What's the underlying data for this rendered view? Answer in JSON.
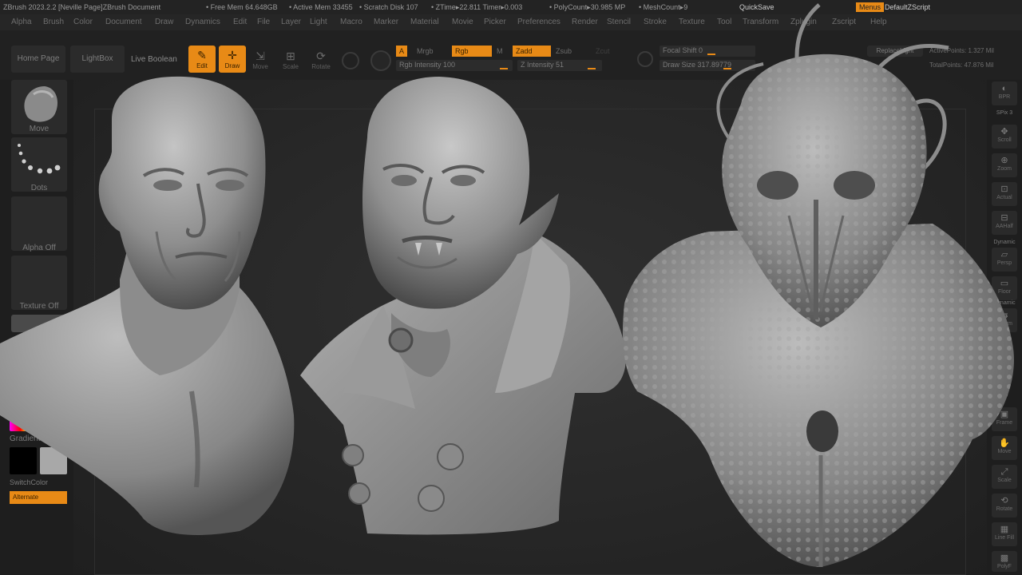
{
  "titlebar": {
    "app": "ZBrush 2023.2.2 [Neville Page]ZBrush Document",
    "free_mem": "• Free Mem 64.648GB",
    "active_mem": "• Active Mem 33455",
    "scratch": "• Scratch Disk 107",
    "ztime": "• ZTime▸22.811 Timer▸0.003",
    "polycount": "• PolyCount▸30.985 MP",
    "meshcount": "• MeshCount▸9",
    "quicksave": "QuickSave",
    "menus_label": "Menus",
    "script_label": "DefaultZScript"
  },
  "menubar": [
    "Alpha",
    "Brush",
    "Color",
    "Document",
    "Draw",
    "Dynamics",
    "Edit",
    "File",
    "Layer",
    "Light",
    "Macro",
    "Marker",
    "Material",
    "Movie",
    "Picker",
    "Preferences",
    "Render",
    "Stencil",
    "Stroke",
    "Texture",
    "Tool",
    "Transform",
    "Zplugin",
    "Zscript",
    "Help"
  ],
  "shelf": {
    "home": "Home Page",
    "lightbox": "LightBox",
    "live_boolean": "Live Boolean",
    "edit": "Edit",
    "draw": "Draw",
    "move": "Move",
    "scale": "Scale",
    "rotate": "Rotate",
    "a_chip": "A",
    "mrgb": "Mrgb",
    "rgb_chip": "Rgb",
    "m": "M",
    "zadd": "Zadd",
    "zsub": "Zsub",
    "zcut": "Zcut",
    "rgb_intensity": "Rgb Intensity 100",
    "z_intensity": "Z Intensity 51",
    "focal_shift": "Focal Shift 0",
    "draw_size": "Draw Size 317.89779",
    "replace_light": "ReplaceLight",
    "active_points": "ActivePoints: 1.327 Mil",
    "total_points": "TotalPoints: 47.876 Mil"
  },
  "lefttray": {
    "brush_label": "Move",
    "stroke_label": "Dots",
    "alpha_label": "Alpha Off",
    "texture_label": "Texture Off",
    "gradient_label": "Gradient",
    "switch_label": "SwitchColor",
    "alternate_label": "Alternate"
  },
  "righttray": {
    "bpr": "BPR",
    "spix": "SPix 3",
    "scroll": "Scroll",
    "zoom": "Zoom",
    "actual": "Actual",
    "aahalf": "AAHalf",
    "dynamic": "Dynamic",
    "persp": "Persp",
    "floor": "Floor",
    "dynamic2": "Dynamic",
    "lsym": "L.Sym",
    "frame": "Frame",
    "move": "Move",
    "scale": "Scale",
    "rotate": "Rotate",
    "line_fill": "Line Fill",
    "polyf": "PolyF"
  },
  "colors": {
    "accent": "#e88a16",
    "background": "#1a1a1a",
    "clay": "#9c9c9c"
  },
  "icons": [
    "edit-icon",
    "draw-icon",
    "move-icon",
    "scale-icon",
    "rotate-icon",
    "sphere-icon"
  ]
}
